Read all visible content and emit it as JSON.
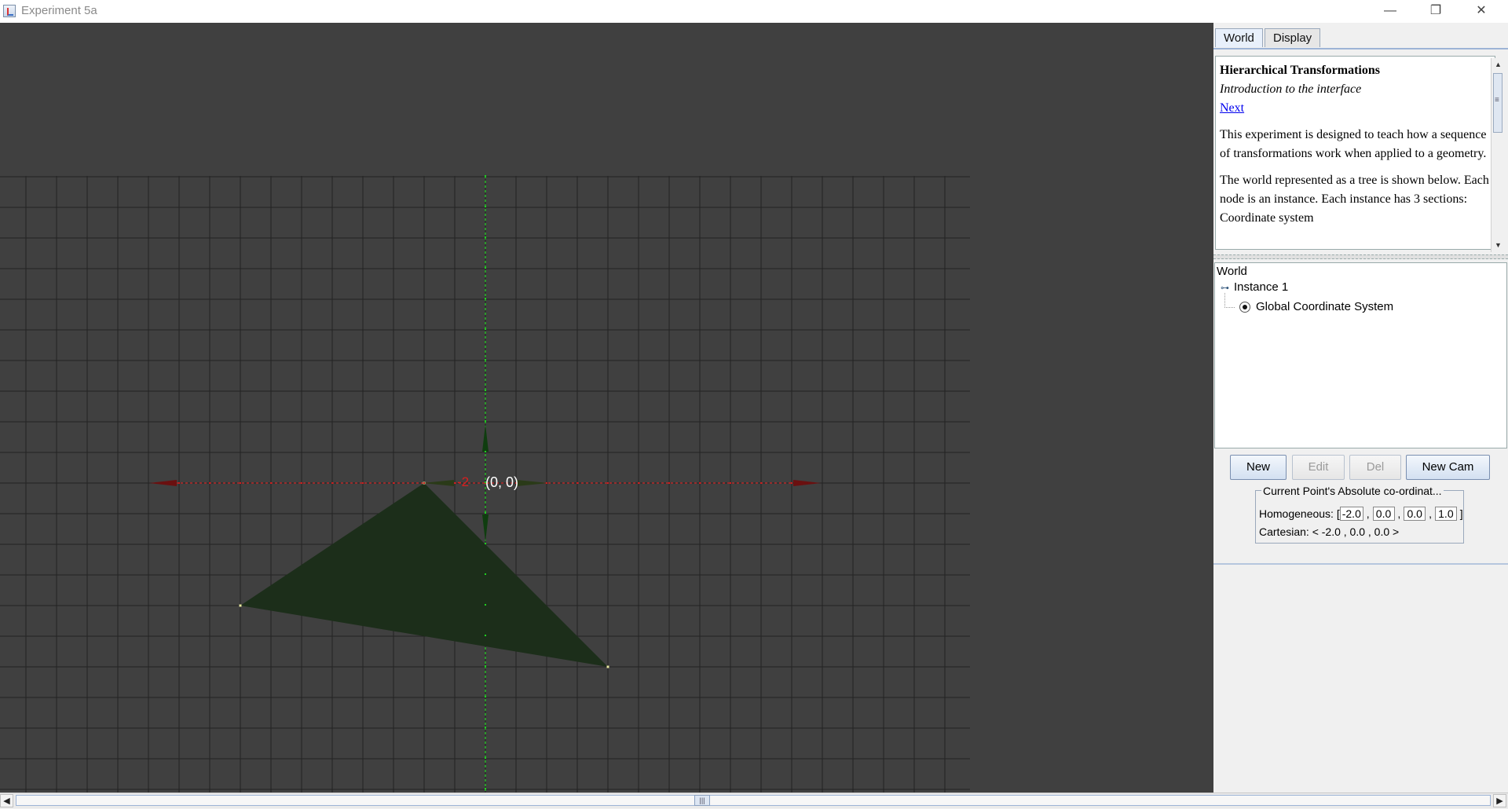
{
  "window": {
    "title": "Experiment 5a",
    "icon": "java-cup-icon",
    "minimize_glyph": "—",
    "maximize_glyph": "❐",
    "close_glyph": "✕"
  },
  "tabs": [
    {
      "label": "World",
      "active": true
    },
    {
      "label": "Display",
      "active": false
    }
  ],
  "info": {
    "heading": "Hierarchical Transformations",
    "subheading": "Introduction to the interface",
    "link": "Next",
    "paragraph1": "This experiment is designed to teach how a sequence of transformations work when applied to a geometry.",
    "paragraph2": "The world represented as a tree is shown below. Each node is an instance. Each instance has 3 sections: Coordinate system"
  },
  "tree": {
    "root": "World",
    "node": "Instance 1",
    "leaf": "Global Coordinate System"
  },
  "buttons": {
    "new": "New",
    "edit": "Edit",
    "del": "Del",
    "new_cam": "New Cam"
  },
  "coords": {
    "legend": "Current Point's Absolute co-ordinat...",
    "homog_label": "Homogeneous: [",
    "homog_values": [
      "-2.0",
      "0.0",
      "0.0",
      "1.0"
    ],
    "homog_close": "]",
    "cartesian": "Cartesian: < -2.0 , 0.0 , 0.0 >"
  },
  "scene": {
    "origin_label": "(0, 0)",
    "x_axis_label": "-2",
    "colors": {
      "background": "#404040",
      "grid": "#222222",
      "x_axis": "#cc1f1f",
      "y_axis": "#1fd11f",
      "triangle_fill": "#1c2e1a",
      "point_marker": "#e8e8a0"
    },
    "triangle_vertices": [
      [
        -2,
        0
      ],
      [
        -8,
        -4
      ],
      [
        4,
        -6
      ]
    ]
  }
}
